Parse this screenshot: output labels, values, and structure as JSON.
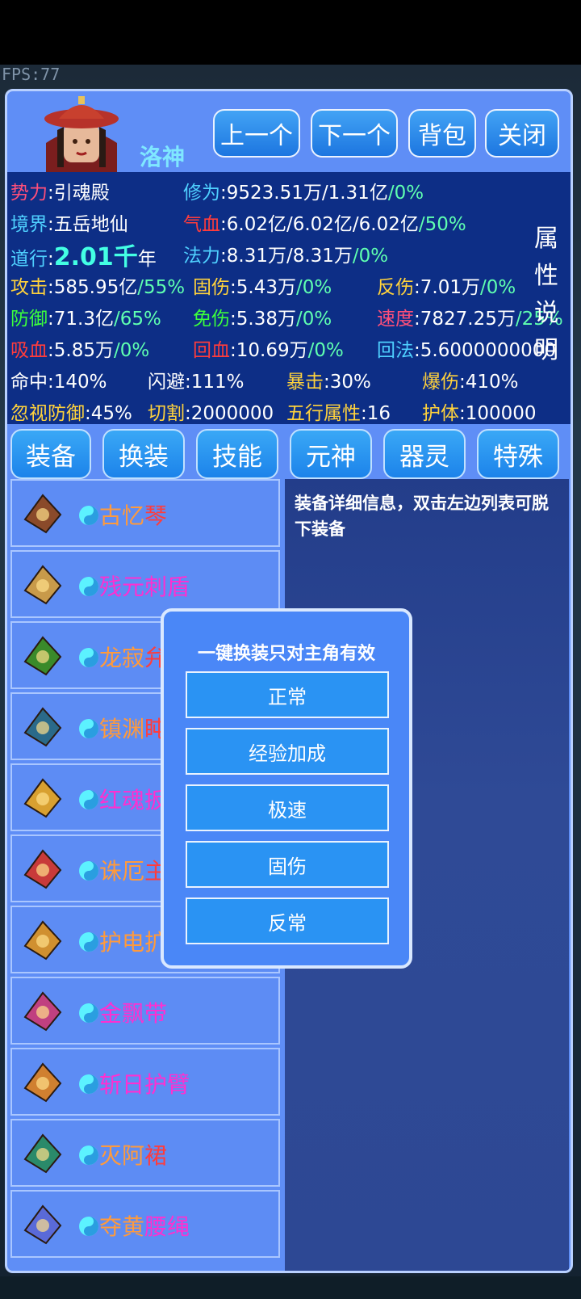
{
  "fps": "FPS:77",
  "header": {
    "name": "洛神",
    "buttons": {
      "prev": "上一个",
      "next": "下一个",
      "bag": "背包",
      "close": "关闭"
    }
  },
  "stats": {
    "faction": {
      "label": "势力",
      "value": ":引魂殿"
    },
    "cultivation": {
      "label": "修为",
      "value": ":9523.51万/1.31亿",
      "pct": "/0%"
    },
    "realm": {
      "label": "境界",
      "value": ":五岳地仙"
    },
    "hp": {
      "label": "气血",
      "value": ":6.02亿/6.02亿/6.02亿",
      "pct": "/50%"
    },
    "dao": {
      "label": "道行",
      "sep": ":",
      "big": "2.01千",
      "unit": "年"
    },
    "mana": {
      "label": "法力",
      "value": ":8.31万/8.31万",
      "pct": "/0%"
    },
    "attack": {
      "label": "攻击",
      "value": ":585.95亿",
      "pct": "/55%"
    },
    "fixed_dmg": {
      "label": "固伤",
      "value": ":5.43万",
      "pct": "/0%"
    },
    "reflect": {
      "label": "反伤",
      "value": ":7.01万",
      "pct": "/0%"
    },
    "defense": {
      "label": "防御",
      "value": ":71.3亿",
      "pct": "/65%"
    },
    "immune": {
      "label": "免伤",
      "value": ":5.38万",
      "pct": "/0%"
    },
    "speed": {
      "label": "速度",
      "value": ":7827.25万",
      "pct": "/25%"
    },
    "lifesteal": {
      "label": "吸血",
      "value": ":5.85万",
      "pct": "/0%"
    },
    "regen": {
      "label": "回血",
      "value": ":10.69万",
      "pct": "/0%"
    },
    "mana_regen": {
      "label": "回法",
      "value": ":5.6000000000"
    },
    "hit": {
      "label": "命中",
      "value": ":140%"
    },
    "dodge": {
      "label": "闪避",
      "value": ":111%"
    },
    "crit": {
      "label": "暴击",
      "value": ":30%"
    },
    "crit_dmg": {
      "label": "爆伤",
      "value": ":410%"
    },
    "ignore_def": {
      "label": "忽视防御",
      "value": ":45%"
    },
    "cut": {
      "label": "切割",
      "value": ":2000000"
    },
    "element": {
      "label": "五行属性",
      "value": ":16"
    },
    "shield": {
      "label": "护体",
      "value": ":100000"
    },
    "side_label": [
      "属",
      "性",
      "说",
      "明"
    ]
  },
  "tabs": [
    "装备",
    "换装",
    "技能",
    "元神",
    "器灵",
    "特殊"
  ],
  "items": [
    {
      "name_a": "古忆",
      "name_b": "琴",
      "color_a": "#ff9a3c",
      "color_b": "#ff3c3c",
      "icon": "qin-icon"
    },
    {
      "name_a": "残元刺盾",
      "name_b": "",
      "color_a": "#ff2fd0",
      "color_b": "#ff2fd0",
      "icon": "shield-icon"
    },
    {
      "name_a": "龙寂",
      "name_b": "弁",
      "color_a": "#ff9a3c",
      "color_b": "#ff3c3c",
      "icon": "helmet-icon"
    },
    {
      "name_a": "镇渊",
      "name_b": "盹",
      "color_a": "#ff9a3c",
      "color_b": "#ff3c3c",
      "icon": "helmet-blue-icon"
    },
    {
      "name_a": "红魂",
      "name_b": "扳",
      "color_a": "#ff2fd0",
      "color_b": "#ff2fd0",
      "icon": "mask-icon"
    },
    {
      "name_a": "诛厄",
      "name_b": "主",
      "color_a": "#ff9a3c",
      "color_b": "#ff3c3c",
      "icon": "armor-icon"
    },
    {
      "name_a": "护电",
      "name_b": "扩",
      "color_a": "#ff9a3c",
      "color_b": "#ff9a3c",
      "icon": "talisman-icon"
    },
    {
      "name_a": "金飘带",
      "name_b": "",
      "color_a": "#ff2fd0",
      "color_b": "#ff2fd0",
      "icon": "ribbon-icon"
    },
    {
      "name_a": "斩日护臂",
      "name_b": "",
      "color_a": "#ff2fd0",
      "color_b": "#ff2fd0",
      "icon": "bracer-icon"
    },
    {
      "name_a": "灭阿",
      "name_b": "裙",
      "color_a": "#ff9a3c",
      "color_b": "#ff3c3c",
      "icon": "skirt-icon"
    },
    {
      "name_a": "夺黄",
      "name_b": "腰绳",
      "color_a": "#ff9a3c",
      "color_b": "#ff2fd0",
      "icon": "belt-icon"
    }
  ],
  "detail": {
    "text": "装备详细信息，双击左边列表可脱下装备"
  },
  "modal": {
    "title": "一键换装只对主角有效",
    "options": [
      "正常",
      "经验加成",
      "极速",
      "固伤",
      "反常"
    ]
  }
}
